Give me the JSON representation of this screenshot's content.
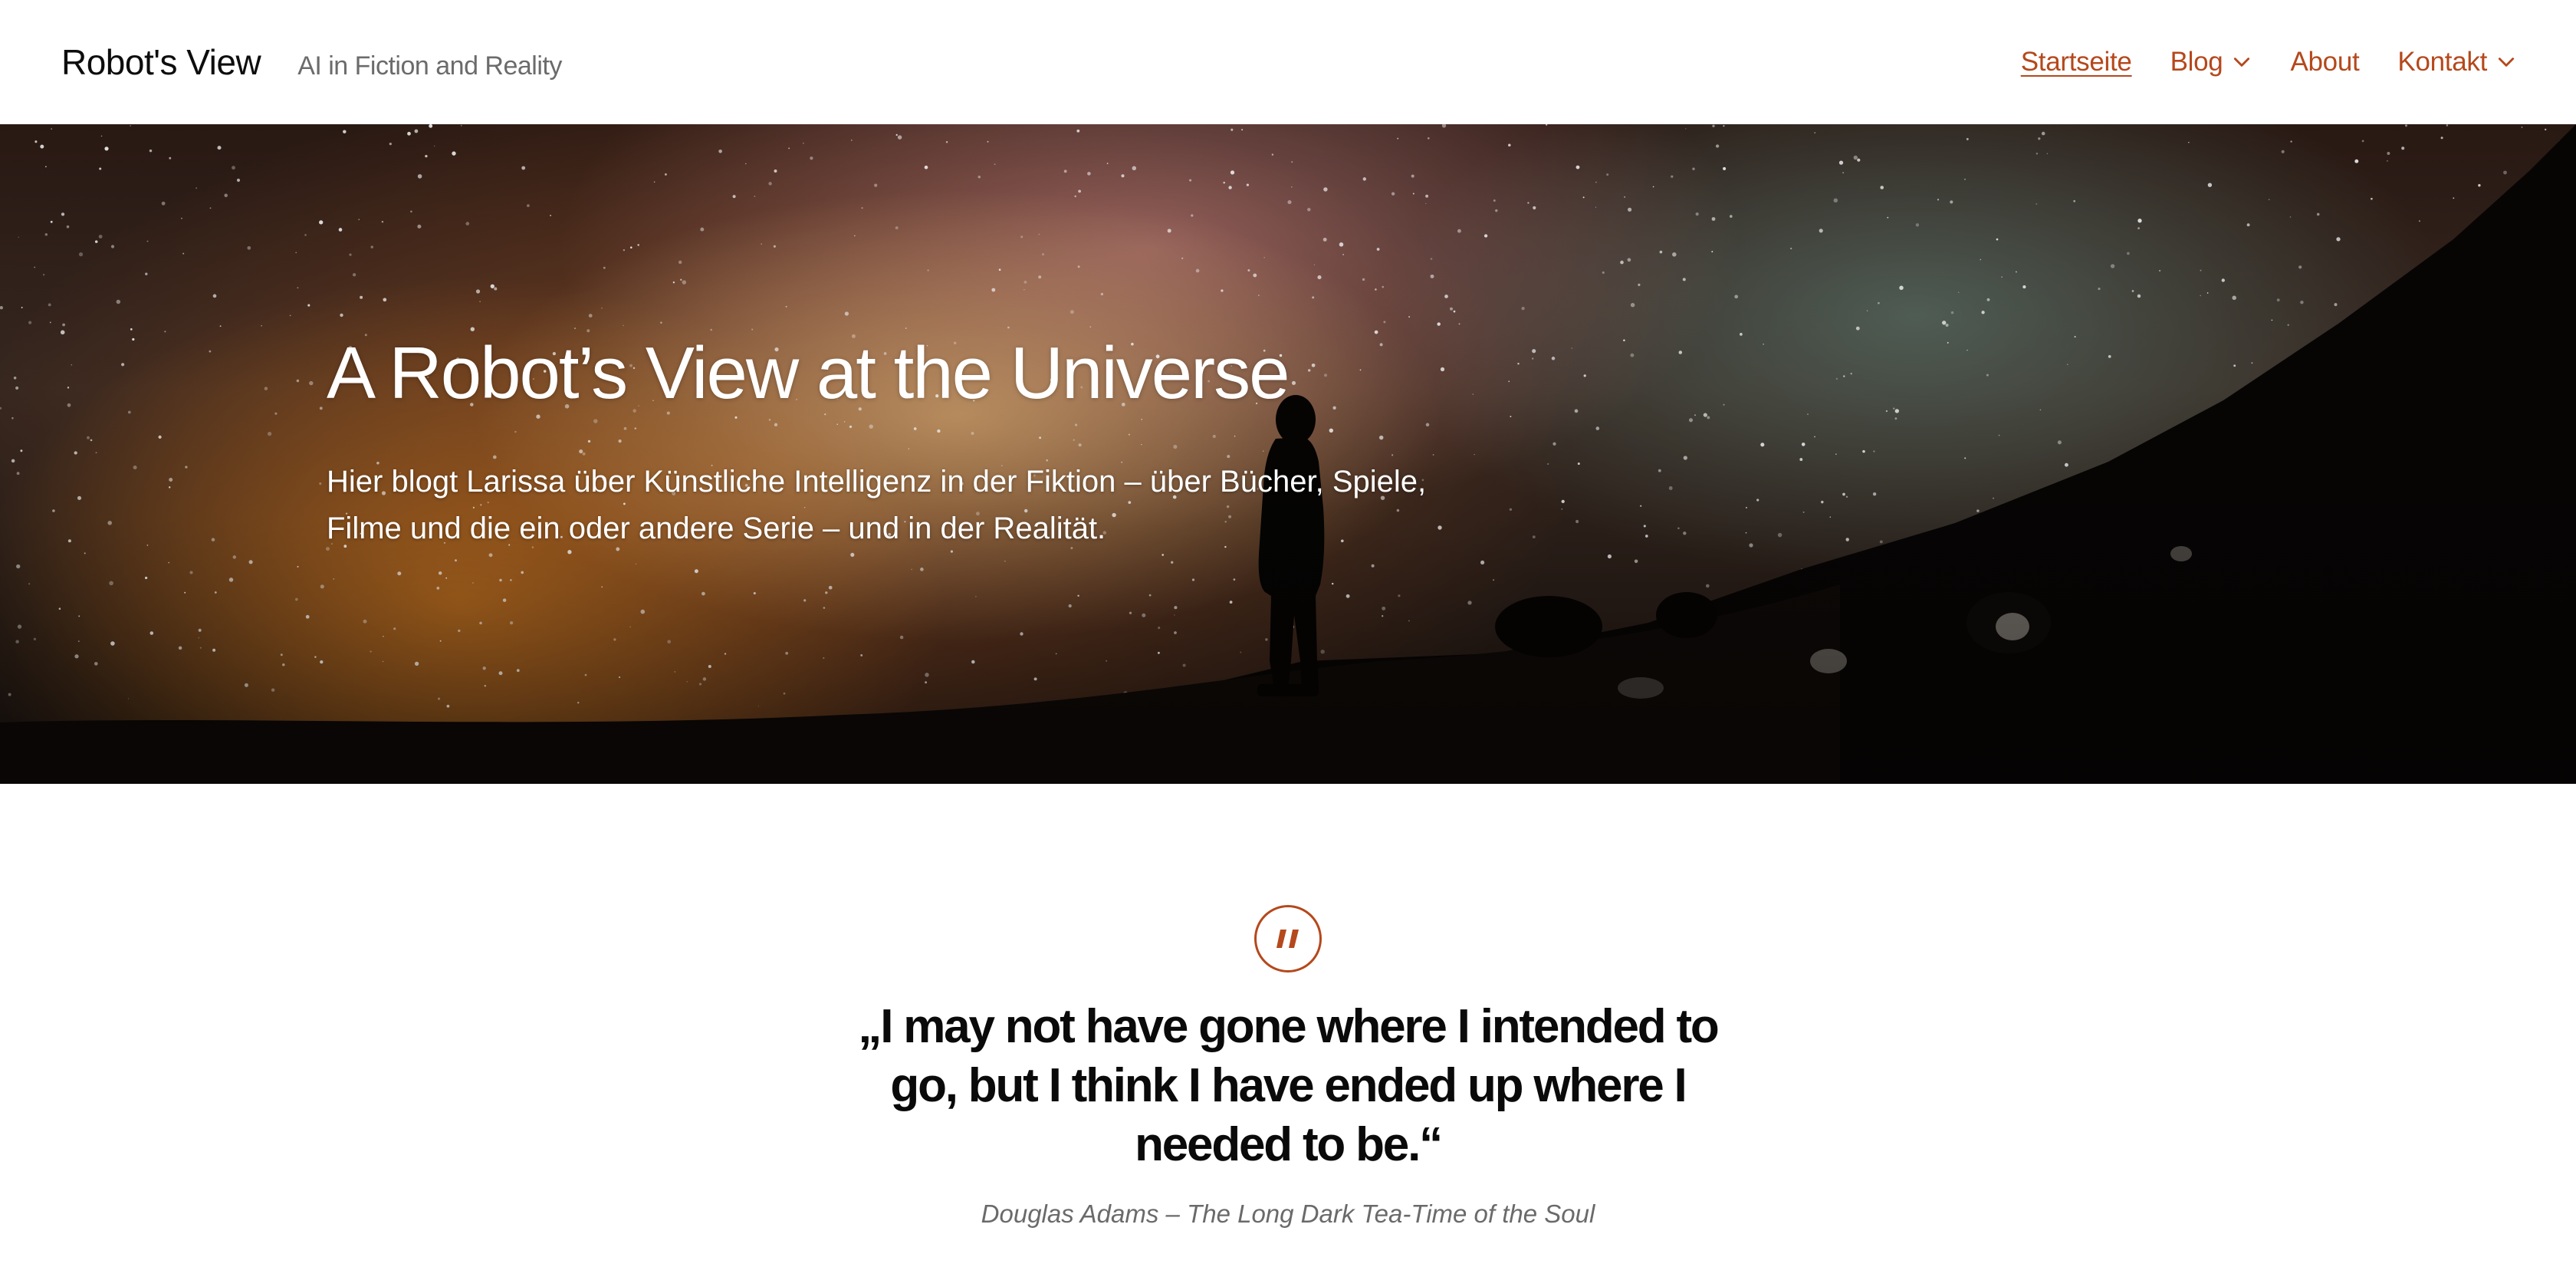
{
  "header": {
    "site_title": "Robot's View",
    "tagline": "AI in Fiction and Reality",
    "nav": [
      {
        "label": "Startseite",
        "current": true,
        "has_submenu": false
      },
      {
        "label": "Blog",
        "current": false,
        "has_submenu": true
      },
      {
        "label": "About",
        "current": false,
        "has_submenu": false
      },
      {
        "label": "Kontakt",
        "current": false,
        "has_submenu": true
      }
    ]
  },
  "hero": {
    "title": "A Robot’s View at the Universe",
    "text": "Hier blogt Larissa über Künstliche Intelligenz in der Fiktion – über Bücher, Spiele, Filme und die ein oder andere Serie – und in der Realität."
  },
  "quote": {
    "icon": "quote-icon",
    "text": "„I may not have gone where I intended to go, but I think I have ended up where I needed to be.“",
    "source": "Douglas Adams – The Long Dark Tea-Time of the Soul"
  },
  "colors": {
    "accent": "#b5481c",
    "title_text": "#0d0d0d",
    "muted_text": "#6b6b6b"
  }
}
